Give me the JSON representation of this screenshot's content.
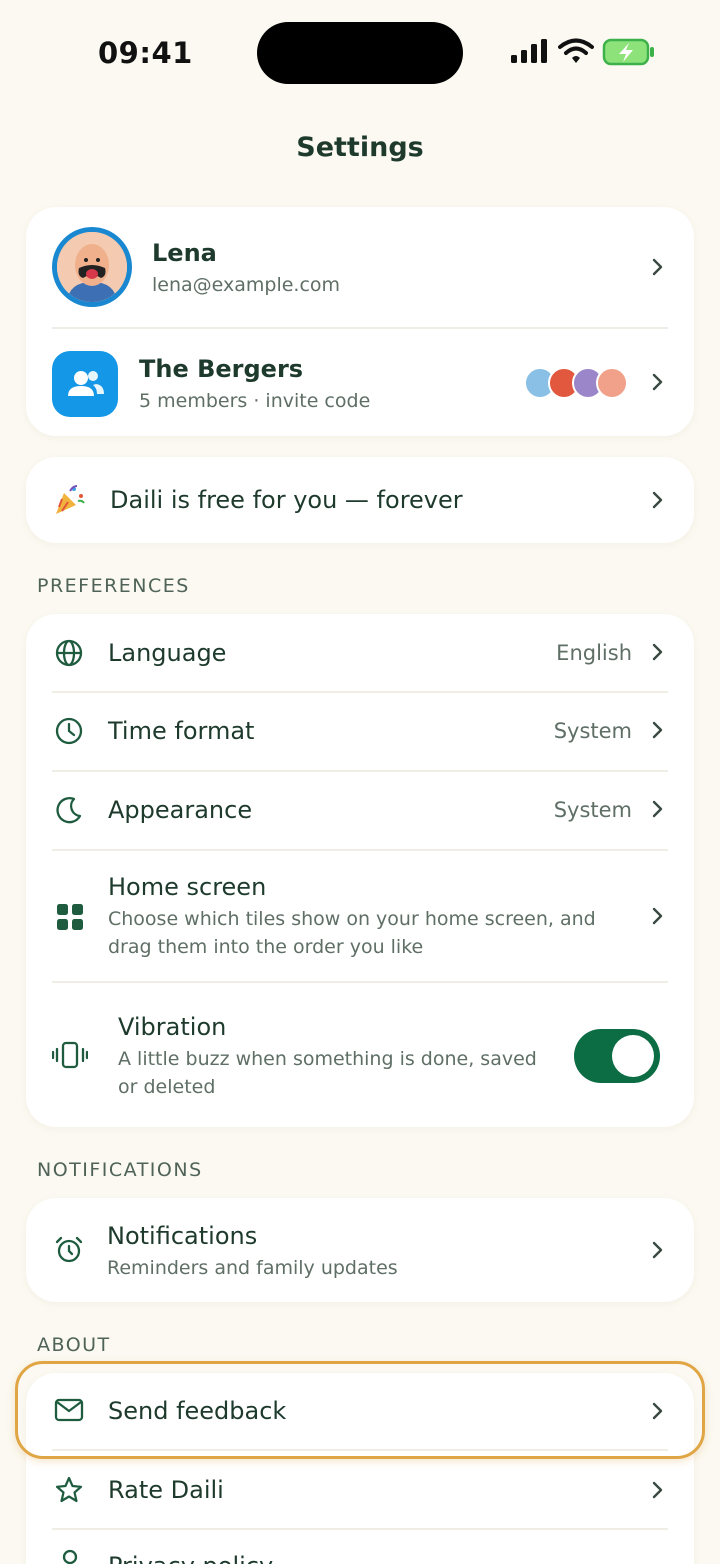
{
  "status": {
    "time": "09:41"
  },
  "header": {
    "title": "Settings"
  },
  "profile": {
    "name": "Lena",
    "email": "lena@example.com"
  },
  "family": {
    "name": "The Bergers",
    "subtitle": "5 members · invite code"
  },
  "promo": {
    "label": "Daili is free for you — forever"
  },
  "preferences": {
    "section_label": "PREFERENCES",
    "language": {
      "label": "Language",
      "value": "English"
    },
    "time_format": {
      "label": "Time format",
      "value": "System"
    },
    "appearance": {
      "label": "Appearance",
      "value": "System"
    },
    "home_screen": {
      "label": "Home screen",
      "description_line1": "Choose which tiles show on your home screen, and",
      "description_line2": "drag them into the order you like"
    },
    "vibration": {
      "label": "Vibration",
      "description_line1": "A little buzz when something is done, saved",
      "description_line2": "or deleted",
      "enabled": true
    }
  },
  "notifications": {
    "section_label": "NOTIFICATIONS",
    "item": {
      "label": "Notifications",
      "description": "Reminders and family updates"
    }
  },
  "about": {
    "section_label": "ABOUT",
    "send_feedback": {
      "label": "Send feedback"
    },
    "rate": {
      "label": "Rate Daili"
    },
    "privacy": {
      "label": "Privacy policy"
    }
  },
  "colors": {
    "accent": "#0c6c43",
    "background": "#fbf9f1",
    "highlight": "#e0a544",
    "family_icon_bg": "#1397e6"
  },
  "icons": {
    "language": "globe-icon",
    "time_format": "clock-icon",
    "appearance": "moon-icon",
    "home_screen": "grid-icon",
    "vibration": "vibrate-icon",
    "notifications": "alarm-clock-icon",
    "send_feedback": "mail-icon",
    "rate": "star-icon",
    "privacy": "person-icon",
    "promo": "party-popper-icon"
  }
}
